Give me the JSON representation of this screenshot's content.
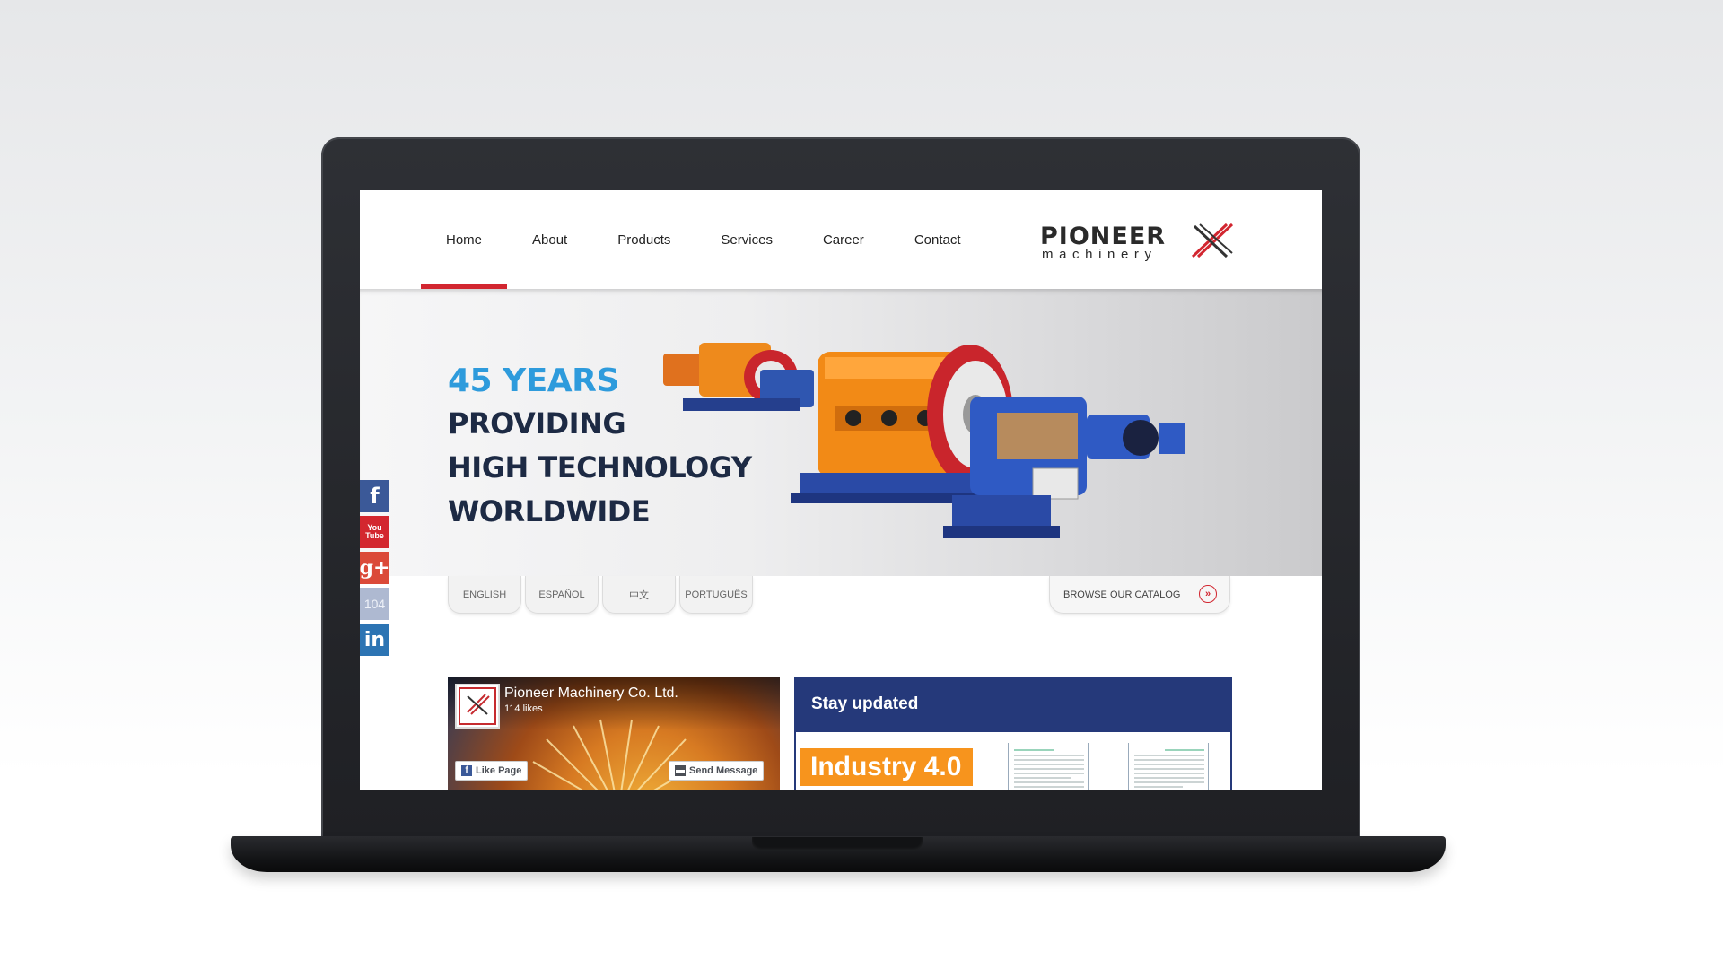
{
  "nav": {
    "items": [
      {
        "label": "Home",
        "active": true
      },
      {
        "label": "About"
      },
      {
        "label": "Products"
      },
      {
        "label": "Services"
      },
      {
        "label": "Career"
      },
      {
        "label": "Contact"
      }
    ]
  },
  "logo": {
    "word": "PIONEER",
    "sub": "machinery"
  },
  "hero": {
    "line1": "45 YEARS",
    "line2": "PROVIDING",
    "line3": "HIGH TECHNOLOGY",
    "line4": "WORLDWIDE"
  },
  "languages": [
    "ENGLISH",
    "ESPAÑOL",
    "中文",
    "PORTUGUÊS"
  ],
  "catalog": {
    "label": "BROWSE OUR CATALOG"
  },
  "social": {
    "facebook": "f",
    "youtube_top": "You",
    "youtube_bottom": "Tube",
    "gplus": "g+",
    "n104": "104",
    "linkedin": "in"
  },
  "facebook_widget": {
    "page_name": "Pioneer Machinery Co. Ltd.",
    "likes": "114 likes",
    "like_button": "Like Page",
    "message_button": "Send Message"
  },
  "stay": {
    "title": "Stay updated",
    "badge": "Industry 4.0"
  },
  "colors": {
    "accent_red": "#d22630",
    "hero_blue": "#2e9bdc",
    "navy": "#25397a",
    "orange": "#f7941d"
  }
}
